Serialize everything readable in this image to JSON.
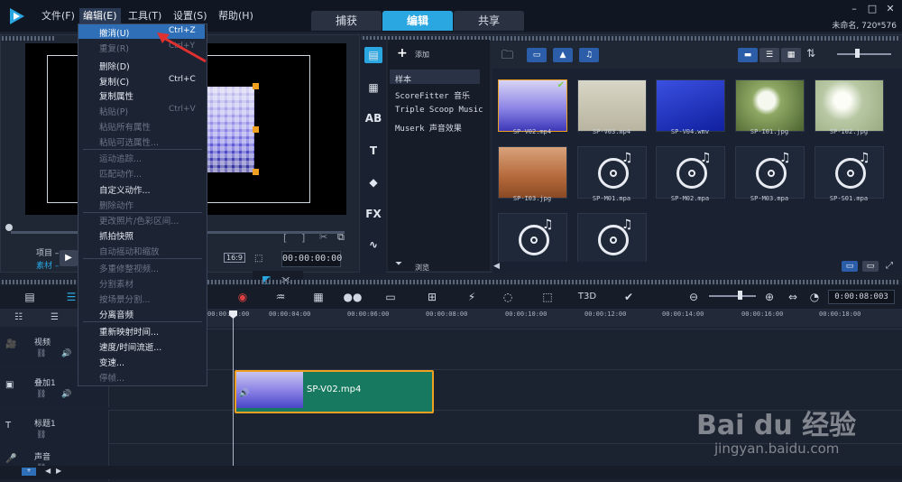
{
  "menubar": {
    "items": [
      "文件(F)",
      "编辑(E)",
      "工具(T)",
      "设置(S)",
      "帮助(H)"
    ],
    "active_index": 1
  },
  "mode_tabs": {
    "items": [
      "捕获",
      "编辑",
      "共享"
    ],
    "active_index": 1
  },
  "window": {
    "project_info": "未命名, 720*576"
  },
  "edit_menu": {
    "items": [
      {
        "label": "撤消(U)",
        "shortcut": "Ctrl+Z",
        "enabled": true,
        "highlighted": true
      },
      {
        "label": "重复(R)",
        "shortcut": "Ctrl+Y",
        "enabled": false
      },
      {
        "label": "删除(D)",
        "shortcut": "",
        "enabled": true
      },
      {
        "label": "复制(C)",
        "shortcut": "Ctrl+C",
        "enabled": true
      },
      {
        "label": "复制属性",
        "shortcut": "",
        "enabled": true
      },
      {
        "label": "粘贴(P)",
        "shortcut": "Ctrl+V",
        "enabled": false
      },
      {
        "label": "粘贴所有属性",
        "shortcut": "",
        "enabled": false
      },
      {
        "label": "粘贴可选属性...",
        "shortcut": "",
        "enabled": false
      },
      {
        "label": "运动追踪...",
        "shortcut": "",
        "enabled": false
      },
      {
        "label": "匹配动作...",
        "shortcut": "",
        "enabled": false
      },
      {
        "label": "自定义动作...",
        "shortcut": "",
        "enabled": true
      },
      {
        "label": "删除动作",
        "shortcut": "",
        "enabled": false
      },
      {
        "label": "更改照片/色彩区间...",
        "shortcut": "",
        "enabled": false
      },
      {
        "label": "抓拍快照",
        "shortcut": "",
        "enabled": true
      },
      {
        "label": "自动摇动和缩放",
        "shortcut": "",
        "enabled": false
      },
      {
        "label": "多重修整视频...",
        "shortcut": "",
        "enabled": false
      },
      {
        "label": "分割素材",
        "shortcut": "",
        "enabled": false
      },
      {
        "label": "按场景分割...",
        "shortcut": "",
        "enabled": false
      },
      {
        "label": "分离音频",
        "shortcut": "",
        "enabled": true
      },
      {
        "label": "重新映射时间...",
        "shortcut": "",
        "enabled": true
      },
      {
        "label": "速度/时间流逝...",
        "shortcut": "",
        "enabled": true
      },
      {
        "label": "变速...",
        "shortcut": "",
        "enabled": true
      },
      {
        "label": "停帧...",
        "shortcut": "",
        "enabled": false
      }
    ]
  },
  "preview": {
    "label_project": "项目 –",
    "label_clip": "素材 –",
    "aspect_ratio": "16:9",
    "timecode": "00:00:00:00"
  },
  "library": {
    "add_label": "添加",
    "browse_label": "浏览",
    "folders": [
      "样本",
      "ScoreFitter 音乐",
      "Triple Scoop Music",
      "Muserk 声音效果"
    ],
    "media": [
      {
        "name": "SP-V02.mp4",
        "kind": "video",
        "checked": true
      },
      {
        "name": "SP-V03.mp4",
        "kind": "video"
      },
      {
        "name": "SP-V04.wmv",
        "kind": "video"
      },
      {
        "name": "SP-I01.jpg",
        "kind": "image"
      },
      {
        "name": "SP-I02.jpg",
        "kind": "image"
      },
      {
        "name": "SP-I03.jpg",
        "kind": "image"
      },
      {
        "name": "SP-M01.mpa",
        "kind": "audio"
      },
      {
        "name": "SP-M02.mpa",
        "kind": "audio"
      },
      {
        "name": "SP-M03.mpa",
        "kind": "audio"
      },
      {
        "name": "SP-S01.mpa",
        "kind": "audio"
      },
      {
        "name": "",
        "kind": "audio"
      },
      {
        "name": "",
        "kind": "audio"
      }
    ]
  },
  "timeline": {
    "timecode": "0:00:08:003",
    "ruler": [
      "00:00:02:00",
      "00:00:04:00",
      "00:00:06:00",
      "00:00:08:00",
      "00:00:10:00",
      "00:00:12:00",
      "00:00:14:00",
      "00:00:16:00",
      "00:00:18:00"
    ],
    "tracks": [
      "视频",
      "叠加1",
      "标题1",
      "声音"
    ],
    "clip_name": "SP-V02.mp4"
  },
  "watermark": {
    "text": "Bai du 经验",
    "url": "jingyan.baidu.com"
  },
  "colors": {
    "accent": "#2aa6e0",
    "highlight": "#2e6fb8",
    "clip": "#17795f",
    "handle": "#f0a020"
  }
}
